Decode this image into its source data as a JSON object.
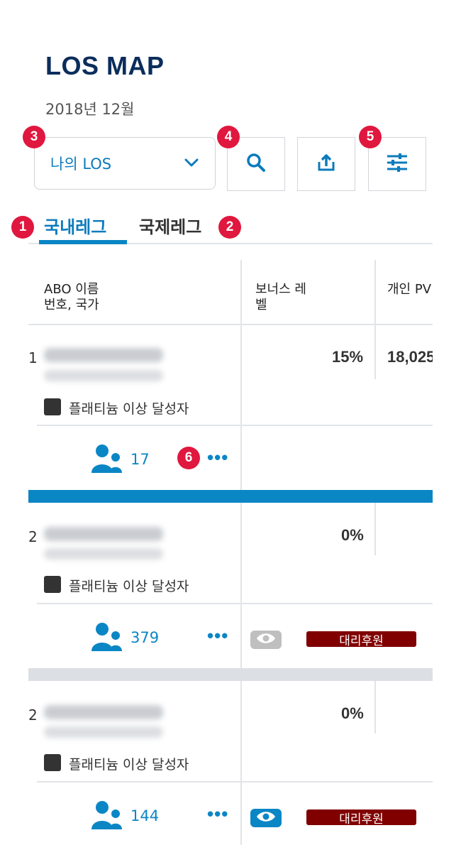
{
  "header": {
    "title": "LOS MAP",
    "date": "2018년 12월"
  },
  "badges": {
    "b1": "1",
    "b2": "2",
    "b3": "3",
    "b4": "4",
    "b5": "5",
    "b6": "6"
  },
  "filter": {
    "selected": "나의 LOS"
  },
  "tabs": [
    {
      "label": "국내레그"
    },
    {
      "label": "국제레그"
    }
  ],
  "columns": {
    "abo_line1": "ABO 이름",
    "abo_line2": "번호, 국가",
    "bonus_line1": "보너스 레",
    "bonus_line2": "벨",
    "pv": "개인 PV"
  },
  "rows": [
    {
      "num": "1",
      "status": "플래티늄 이상 달성자",
      "bonus": "15%",
      "pv": "18,025",
      "count": "17",
      "more": "•••"
    },
    {
      "num": "2",
      "status": "플래티늄 이상 달성자",
      "bonus": "0%",
      "count": "379",
      "more": "•••",
      "tag": "대리후원"
    },
    {
      "num": "2",
      "status": "플래티늄 이상 달성자",
      "bonus": "0%",
      "count": "144",
      "more": "•••",
      "tag": "대리후원"
    }
  ],
  "colors": {
    "accent": "#0b86c5",
    "title": "#0b2d5b",
    "badge": "#e0173e",
    "tag": "#800000",
    "eye_off": "#bfbfbf",
    "eye_on": "#0b86c5"
  }
}
